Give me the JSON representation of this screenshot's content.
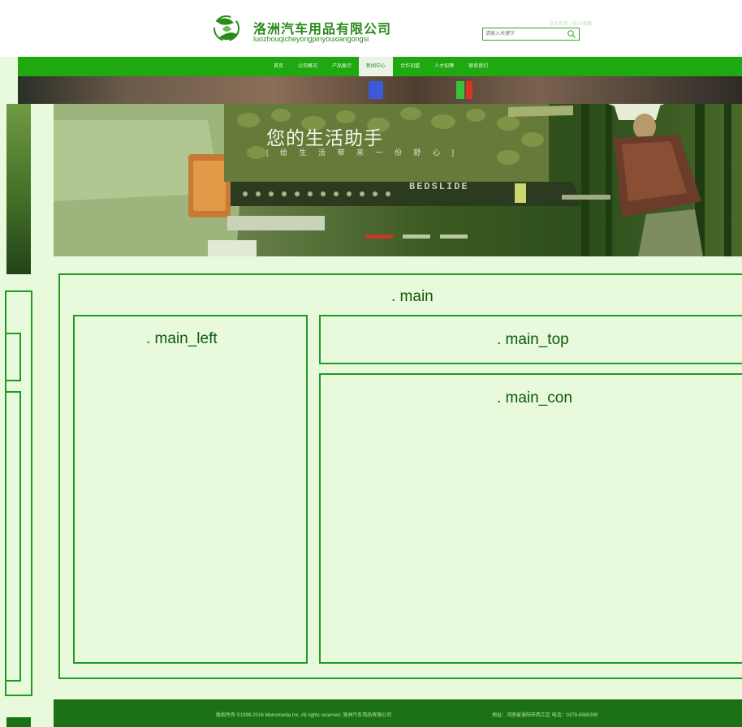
{
  "header": {
    "brand_cn": "洛洲汽车用品有限公司",
    "brand_en": "luozhouqicheyongpinyouxiangongsi",
    "top_link": "设为首页 | 加入收藏",
    "search": {
      "placeholder": "请输入关键字"
    }
  },
  "nav": {
    "items": [
      {
        "label": "首页"
      },
      {
        "label": "公司概况"
      },
      {
        "label": "产品展示"
      },
      {
        "label": "新闻中心",
        "active": true
      },
      {
        "label": "合作加盟"
      },
      {
        "label": "人才招聘"
      },
      {
        "label": "联系我们"
      }
    ]
  },
  "hero": {
    "title": "您的生活助手",
    "subtitle": "[ 给 生 活 带 来 一 份 舒 心 ]",
    "product_label": "BEDSLIDE",
    "slides": 3,
    "active_slide": 1
  },
  "layout_labels": {
    "main": ". main",
    "main_left": ". main_left",
    "main_top": ". main_top",
    "main_con": ". main_con"
  },
  "footer": {
    "copyright": "版权所有 ©1999-2016 Metromedia Inc. All rights reserved. 洛洲汽车用品有限公司",
    "contact": "地址：河南省洛阳市西工区 电话：0379-6565399"
  },
  "colors": {
    "nav": "#1ea910",
    "footer": "#1b7114",
    "box_border": "#1f9a22",
    "page_bg": "#e8f9dc",
    "active_dot": "#c43a28"
  }
}
